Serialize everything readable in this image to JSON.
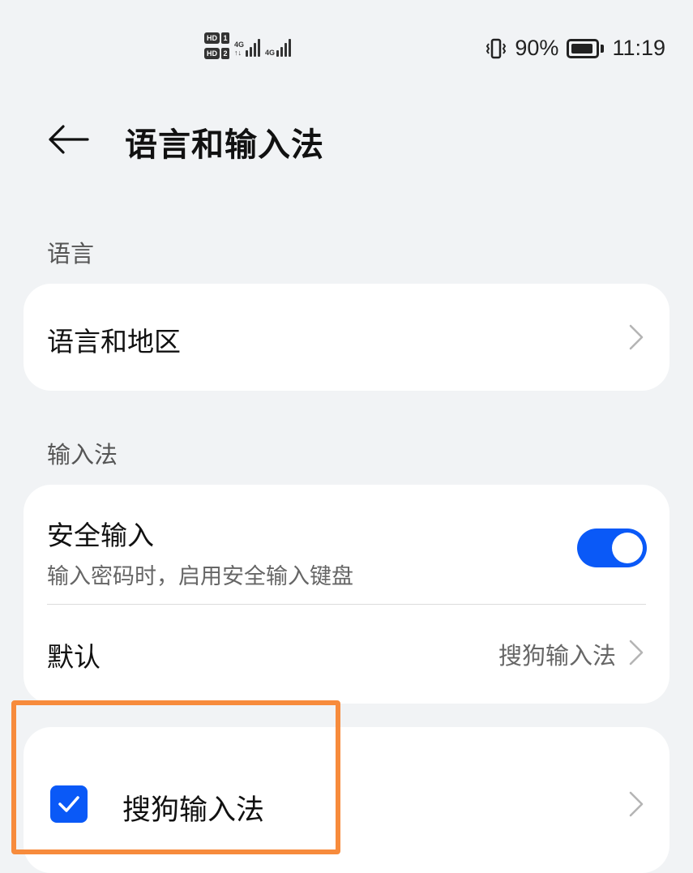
{
  "status_bar": {
    "sim1_label": "HD",
    "sim1_num": "1",
    "sim2_label": "HD",
    "sim2_num": "2",
    "net1_label": "4G",
    "net1_sub": "↑↓",
    "net2_label": "4G",
    "battery_percent": "90%",
    "time": "11:19",
    "icons": [
      "vibrate-icon",
      "battery-icon",
      "signal-icon"
    ]
  },
  "header": {
    "back_icon": "arrow-left-icon",
    "title": "语言和输入法"
  },
  "sections": {
    "language": {
      "label": "语言",
      "items": [
        {
          "title": "语言和地区"
        }
      ]
    },
    "input_method": {
      "label": "输入法",
      "secure_input": {
        "title": "安全输入",
        "subtitle": "输入密码时，启用安全输入键盘",
        "enabled": true
      },
      "default": {
        "title": "默认",
        "value": "搜狗输入法"
      }
    },
    "keyboards": {
      "items": [
        {
          "title": "搜狗输入法",
          "checked": true
        }
      ]
    }
  },
  "colors": {
    "accent": "#0a59f7",
    "background": "#f1f3f5",
    "card": "#ffffff",
    "highlight": "#f78b3c"
  }
}
